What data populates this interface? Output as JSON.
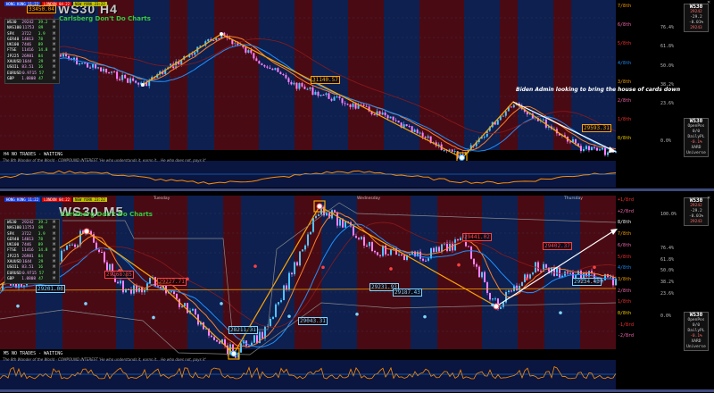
{
  "colors": {
    "bg": "#000000",
    "session_red": "#4a0a14",
    "session_blue": "#0d2050",
    "zigzag": "#ffa500",
    "arrow": "#ffffff",
    "bull": "#4fc3ff",
    "bear": "#ff80ff"
  },
  "charts": [
    {
      "id": "top",
      "title": "WS30 H4",
      "subtitle": "Carlsberg Don't Do Charts",
      "price_tag_top": "33450.04",
      "sessions": [
        "HONG KONG 11:22",
        "LONDON 04:22",
        "NEW YORK 23:22"
      ],
      "mini_table": [
        [
          "WS30",
          "29242",
          "39.2",
          "M"
        ],
        [
          "NAS100",
          "11753",
          "89",
          "M"
        ],
        [
          "SPX",
          "3722",
          "3.9",
          "M"
        ],
        [
          "GER40",
          "14013",
          "78",
          "M"
        ],
        [
          "UK100",
          "7446",
          "89",
          "M"
        ],
        [
          "FTSE",
          "11416",
          "14.8",
          "M"
        ],
        [
          "JP225",
          "26981",
          "84",
          "M"
        ],
        [
          "XAUUSD",
          "1644",
          "29",
          "M"
        ],
        [
          "USOIL",
          "83.51",
          "16",
          "M"
        ],
        [
          "EURUSD",
          "0.9715",
          "57",
          "M"
        ],
        [
          "GBP",
          "1.0808",
          "47",
          "M"
        ]
      ],
      "price_labels": [
        {
          "text": "31140.57",
          "color": "#ffa500"
        },
        {
          "text": "29593.31",
          "color": "#ffa500"
        }
      ],
      "annotation": "Biden Admin looking to bring the house of cards down",
      "status": "H4  NO TRADES - WAITING",
      "ticker": "The 8th Wonder of the World - COMPOUND INTEREST  'He who understands it, earns it... He who does not, pays it'",
      "fib_levels": [
        {
          "label": "7/8th",
          "pct": "",
          "color": "#ffa500"
        },
        {
          "label": "6/8th",
          "pct": "76.4%",
          "color": "#ff69b4"
        },
        {
          "label": "5/8th",
          "pct": "61.8%",
          "color": "#ff3030"
        },
        {
          "label": "4/8th",
          "pct": "50.0%",
          "color": "#1e90ff"
        },
        {
          "label": "3/8th",
          "pct": "38.2%",
          "color": "#ffa500"
        },
        {
          "label": "2/8th",
          "pct": "23.6%",
          "color": "#ff69b4"
        },
        {
          "label": "1/8th",
          "pct": "",
          "color": "#ff3030"
        },
        {
          "label": "0/8th",
          "pct": "0.0%",
          "color": "#ffd700"
        }
      ],
      "right_box_top": {
        "title": "WS30",
        "price": "29242",
        "lines": [
          "-29.2",
          "-0.01%"
        ],
        "red": "29243"
      },
      "right_box_bottom": {
        "title": "WS30",
        "lines": [
          "OpenPos",
          "0/0",
          "DailyPL",
          "-0.1%",
          "XARD",
          "Universe"
        ]
      }
    },
    {
      "id": "bottom",
      "title": "WS30 M5",
      "subtitle": "Carlsberg Don't Do Charts",
      "sessions": [
        "HONG KONG 11:22",
        "LONDON 04:22",
        "NEW YORK 23:22"
      ],
      "mini_table": [
        [
          "WS30",
          "29242",
          "39.2",
          "M"
        ],
        [
          "NAS100",
          "11753",
          "89",
          "M"
        ],
        [
          "SPX",
          "3722",
          "3.9",
          "M"
        ],
        [
          "GER40",
          "14013",
          "78",
          "M"
        ],
        [
          "UK100",
          "7446",
          "89",
          "M"
        ],
        [
          "FTSE",
          "11416",
          "14.8",
          "M"
        ],
        [
          "JP225",
          "26981",
          "84",
          "M"
        ],
        [
          "XAUUSD",
          "1644",
          "29",
          "M"
        ],
        [
          "USOIL",
          "83.51",
          "16",
          "M"
        ],
        [
          "EURUSD",
          "0.9715",
          "57",
          "M"
        ],
        [
          "GBP",
          "1.0808",
          "47",
          "M"
        ]
      ],
      "day_labels": [
        "Tuesday",
        "Wednesday",
        "Thursday"
      ],
      "price_labels": [
        {
          "text": "29268.85",
          "color": "#ff4040"
        },
        {
          "text": "29201.00",
          "color": "#7fd4ff"
        },
        {
          "text": "29227.71",
          "color": "#ff4040"
        },
        {
          "text": "28211.31",
          "color": "#7fd4ff"
        },
        {
          "text": "29043.31",
          "color": "#7fd4ff"
        },
        {
          "text": "29441.02",
          "color": "#ff4040"
        },
        {
          "text": "29231.93",
          "color": "#7fd4ff"
        },
        {
          "text": "29187.43",
          "color": "#7fd4ff"
        },
        {
          "text": "29402.37",
          "color": "#ff4040"
        },
        {
          "text": "29234.43",
          "color": "#7fd4ff"
        }
      ],
      "status": "M5  NO TRADES - WAITING",
      "ticker": "The 8th Wonder of the World - COMPOUND INTEREST  'He who understands it, earns it... He who does not, pays it'",
      "fib_levels": [
        {
          "label": "+1/8rd",
          "pct": "",
          "color": "#ff3030"
        },
        {
          "label": "+2/8rd",
          "pct": "100.0%",
          "color": "#ff69b4"
        },
        {
          "label": "8/8th",
          "pct": "",
          "color": "#ffffff"
        },
        {
          "label": "7/8th",
          "pct": "",
          "color": "#ffa500"
        },
        {
          "label": "6/8th",
          "pct": "76.4%",
          "color": "#ff69b4"
        },
        {
          "label": "5/8th",
          "pct": "61.8%",
          "color": "#ff3030"
        },
        {
          "label": "4/8th",
          "pct": "50.0%",
          "color": "#1e90ff"
        },
        {
          "label": "3/8th",
          "pct": "38.2%",
          "color": "#ffa500"
        },
        {
          "label": "2/8th",
          "pct": "23.6%",
          "color": "#ff69b4"
        },
        {
          "label": "1/8th",
          "pct": "",
          "color": "#ff3030"
        },
        {
          "label": "0/8th",
          "pct": "0.0%",
          "color": "#ffd700"
        },
        {
          "label": "-1/8rd",
          "pct": "",
          "color": "#ff3030"
        },
        {
          "label": "-2/8rd",
          "pct": "",
          "color": "#ff69b4"
        }
      ],
      "right_box_top": {
        "title": "WS30",
        "price": "29242",
        "lines": [
          "-29.2",
          "-0.01%"
        ],
        "red": "29243"
      },
      "right_box_bottom": {
        "title": "WS30",
        "lines": [
          "OpenPos",
          "0/0",
          "DailyPL",
          "-0.1%",
          "XARD",
          "Universe"
        ]
      }
    }
  ]
}
